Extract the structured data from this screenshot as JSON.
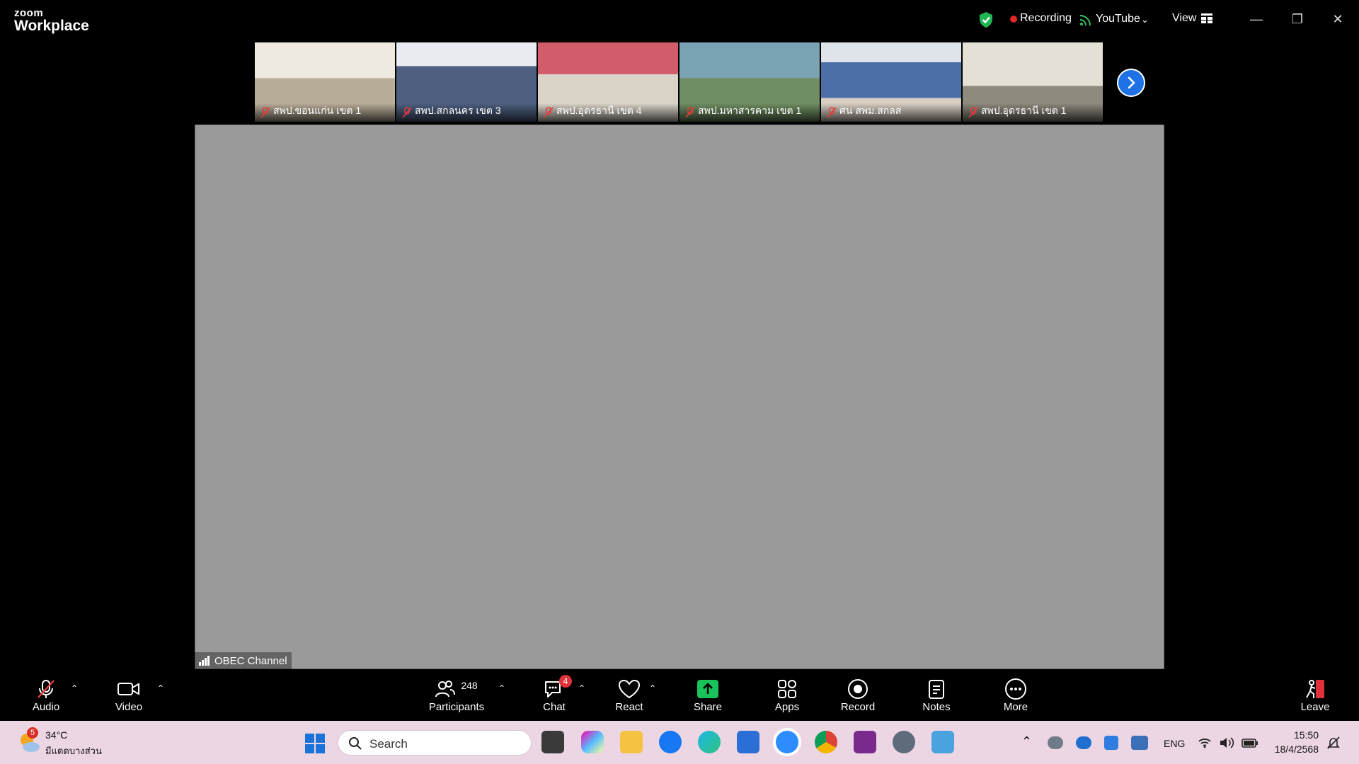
{
  "app": {
    "brand_small": "zoom",
    "brand_big": "Workplace"
  },
  "topbar": {
    "recording_label": "Recording",
    "stream_label": "YouTube",
    "view_label": "View",
    "status_color": "#e02828",
    "accent": "#1e72e6"
  },
  "gallery": [
    {
      "name": "สพป.ขอนแก่น เขต 1",
      "color": "#d8cdb6"
    },
    {
      "name": "สพป.สกลนคร เขต 3",
      "color": "#5a6e8c"
    },
    {
      "name": "สพป.อุดรธานี เขต 4",
      "color": "#c46a6e"
    },
    {
      "name": "สพป.มหาสารคาม เขต 1",
      "color": "#5f8f6a"
    },
    {
      "name": "ศน สพม.สกลส",
      "color": "#6a7fa6"
    },
    {
      "name": "สพป.อุดรธานี เขต 1",
      "color": "#c8c3b4"
    }
  ],
  "main": {
    "speaker_label": "OBEC Channel"
  },
  "toolbar": {
    "audio": "Audio",
    "video": "Video",
    "participants": "Participants",
    "participants_count": "248",
    "chat": "Chat",
    "chat_badge": "4",
    "react": "React",
    "share": "Share",
    "apps": "Apps",
    "record": "Record",
    "notes": "Notes",
    "more": "More",
    "leave": "Leave",
    "share_color": "#19c25a",
    "leave_color": "#e0303a"
  },
  "taskbar": {
    "weather_temp": "34°C",
    "weather_desc": "มีแดดบางส่วน",
    "weather_badge": "5",
    "search_placeholder": "Search",
    "lang": "ENG",
    "time": "15:50",
    "date": "18/4/2568"
  }
}
